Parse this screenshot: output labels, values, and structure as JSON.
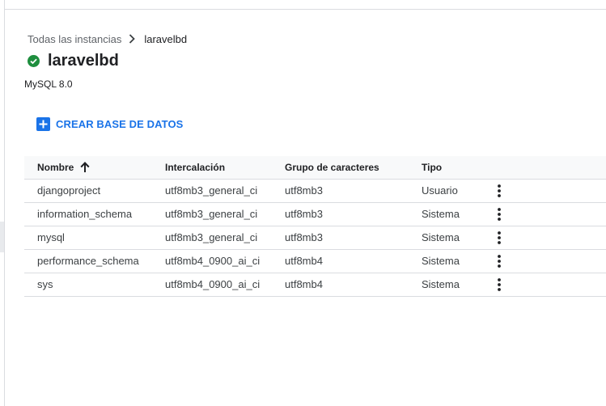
{
  "breadcrumb": {
    "parent": "Todas las instancias",
    "current": "laravelbd"
  },
  "instance": {
    "name": "laravelbd",
    "version": "MySQL 8.0",
    "status_icon": "check-circle-icon",
    "status_color": "#1e8e3e"
  },
  "actions": {
    "create_label": "CREAR BASE DE DATOS",
    "create_icon": "add-box-icon",
    "accent": "#1a73e8"
  },
  "table": {
    "headers": {
      "name": "Nombre",
      "collation": "Intercalación",
      "charset": "Grupo de caracteres",
      "type": "Tipo"
    },
    "sort": {
      "column": "Nombre",
      "direction": "ascending",
      "icon": "arrow-up-icon"
    },
    "rows": [
      {
        "name": "djangoproject",
        "collation": "utf8mb3_general_ci",
        "charset": "utf8mb3",
        "type": "Usuario"
      },
      {
        "name": "information_schema",
        "collation": "utf8mb3_general_ci",
        "charset": "utf8mb3",
        "type": "Sistema"
      },
      {
        "name": "mysql",
        "collation": "utf8mb3_general_ci",
        "charset": "utf8mb3",
        "type": "Sistema"
      },
      {
        "name": "performance_schema",
        "collation": "utf8mb4_0900_ai_ci",
        "charset": "utf8mb4",
        "type": "Sistema"
      },
      {
        "name": "sys",
        "collation": "utf8mb4_0900_ai_ci",
        "charset": "utf8mb4",
        "type": "Sistema"
      }
    ],
    "row_menu_icon": "more-vert-icon"
  }
}
